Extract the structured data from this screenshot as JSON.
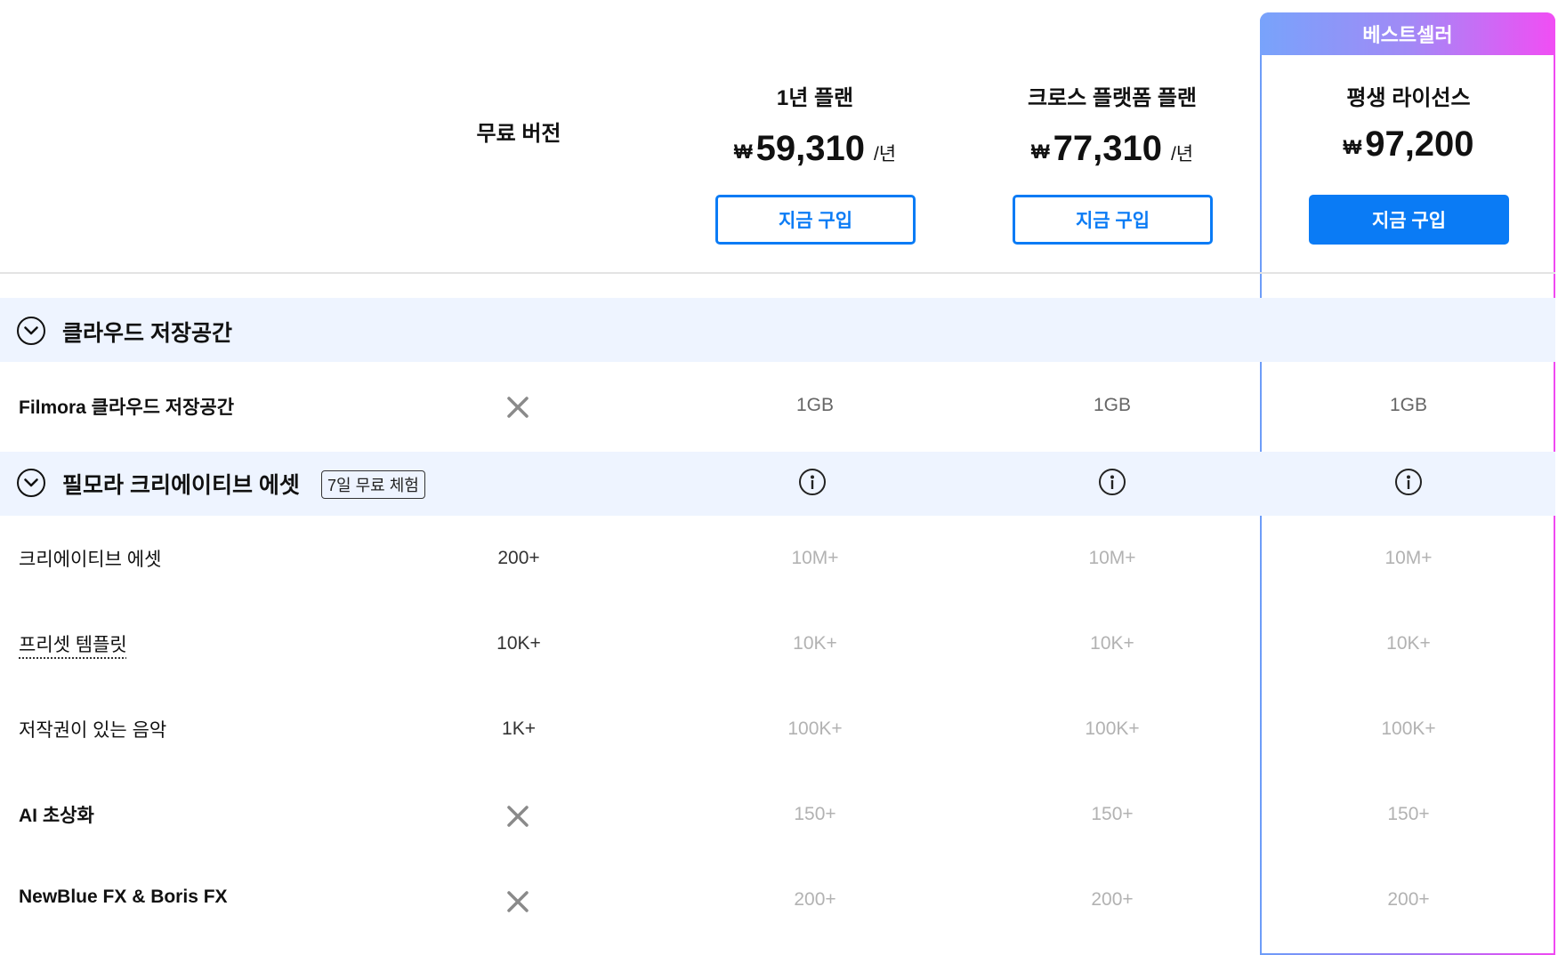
{
  "highlight": {
    "ribbon_label": "베스트셀러"
  },
  "plans": [
    {
      "title": "무료 버전"
    },
    {
      "title": "1년 플랜",
      "currency": "₩",
      "price": "59,310",
      "period": "/년",
      "button": "지금 구입"
    },
    {
      "title": "크로스 플랫폼 플랜",
      "currency": "₩",
      "price": "77,310",
      "period": "/년",
      "button": "지금 구입"
    },
    {
      "title": "평생 라이선스",
      "currency": "₩",
      "price": "97,200",
      "button": "지금 구입"
    }
  ],
  "sections": [
    {
      "title": "클라우드 저장공간",
      "rows": [
        {
          "label": "Filmora 클라우드 저장공간",
          "free": "",
          "plan1": "1GB",
          "plan2": "1GB",
          "plan3": "1GB",
          "free_excluded": true
        }
      ]
    },
    {
      "title": "필모라 크리에이티브 에셋",
      "badge": "7일 무료 체험",
      "rows": [
        {
          "label": "크리에이티브 에셋",
          "free": "200+",
          "plan1": "10M+",
          "plan2": "10M+",
          "plan3": "10M+"
        },
        {
          "label": "프리셋 템플릿",
          "free": "10K+",
          "plan1": "10K+",
          "plan2": "10K+",
          "plan3": "10K+"
        },
        {
          "label": "저작권이 있는 음악",
          "free": "1K+",
          "plan1": "100K+",
          "plan2": "100K+",
          "plan3": "100K+"
        },
        {
          "label": "AI 초상화",
          "free": "",
          "plan1": "150+",
          "plan2": "150+",
          "plan3": "150+",
          "free_excluded": true
        },
        {
          "label": "NewBlue FX & Boris FX",
          "free": "",
          "plan1": "200+",
          "plan2": "200+",
          "plan3": "200+",
          "free_excluded": true
        }
      ]
    }
  ],
  "icons": {
    "collapse": "chevron-down-circle-icon",
    "excluded": "x-icon",
    "info": "info-icon"
  },
  "colors": {
    "accent": "#0a7bf5",
    "section_bg": "#eef4ff"
  }
}
